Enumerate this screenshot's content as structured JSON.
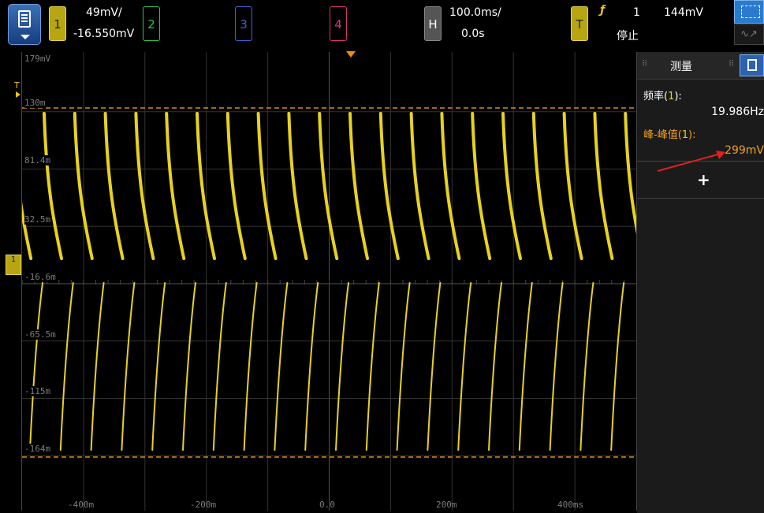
{
  "channel1": {
    "number": "1",
    "scale": "49mV/",
    "offset": "-16.550mV",
    "color": "#b7a512"
  },
  "channel2": {
    "number": "2",
    "color": "#29c24a"
  },
  "channel3": {
    "number": "3",
    "color": "#3c63d6"
  },
  "channel4": {
    "number": "4",
    "color": "#d8337a"
  },
  "horizontal": {
    "label": "H",
    "scale": "100.0ms/",
    "delay": "0.0s"
  },
  "trigger": {
    "label": "T",
    "source": "1",
    "level": "144mV",
    "status": "停止"
  },
  "screen": {
    "y_labels": [
      "179mV",
      "130m",
      "81.4m",
      "32.5m",
      "-16.6m",
      "-65.5m",
      "-115m",
      "-164m"
    ],
    "x_labels": [
      "-400m",
      "-200m",
      "0.0",
      "200m",
      "400ms"
    ],
    "trigger_marker": "T",
    "channel_marker": "1"
  },
  "measure_panel": {
    "title": "测量",
    "freq_label_pre": "频率(",
    "freq_label_ch": "1",
    "freq_label_post": "):",
    "freq_value": "19.986Hz",
    "pp_label_pre": "峰-峰值(",
    "pp_label_ch": "1",
    "pp_label_post": "):",
    "pp_value": "299mV",
    "add_label": "+"
  },
  "colors": {
    "trace": "#e8d21c",
    "cursor": "#d98a1a",
    "highlight": "#f0a020",
    "annotation_arrow": "#e02020"
  }
}
